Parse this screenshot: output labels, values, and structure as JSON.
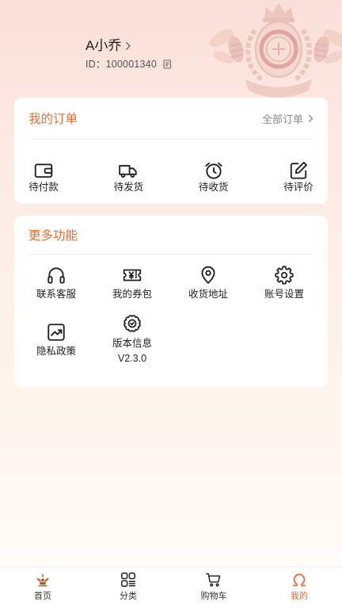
{
  "profile": {
    "name": "A小乔",
    "id_text": "ID：100001340"
  },
  "orders": {
    "title": "我的订单",
    "all_orders_label": "全部订单",
    "items": [
      {
        "label": "待付款",
        "icon": "wallet-icon"
      },
      {
        "label": "待发货",
        "icon": "truck-icon"
      },
      {
        "label": "待收货",
        "icon": "alarm-clock-icon"
      },
      {
        "label": "待评价",
        "icon": "edit-icon"
      }
    ]
  },
  "features": {
    "title": "更多功能",
    "items": [
      {
        "label": "联系客服",
        "icon": "headphones-icon"
      },
      {
        "label": "我的券包",
        "icon": "coupon-icon"
      },
      {
        "label": "收货地址",
        "icon": "location-pin-icon"
      },
      {
        "label": "账号设置",
        "icon": "gear-icon"
      },
      {
        "label": "隐私政策",
        "icon": "trend-chart-icon"
      },
      {
        "label": "版本信息",
        "icon": "badge-icon",
        "sub": "V2.3.0"
      }
    ]
  },
  "tabbar": {
    "active_index": 3,
    "items": [
      {
        "label": "首页",
        "icon": "home-logo-icon"
      },
      {
        "label": "分类",
        "icon": "category-grid-icon"
      },
      {
        "label": "购物车",
        "icon": "cart-icon"
      },
      {
        "label": "我的",
        "icon": "profile-omega-icon"
      }
    ]
  },
  "colors": {
    "accent": "#E36B35",
    "text_primary": "#222222",
    "text_secondary": "#888888",
    "card_background": "#FFFFFF"
  }
}
